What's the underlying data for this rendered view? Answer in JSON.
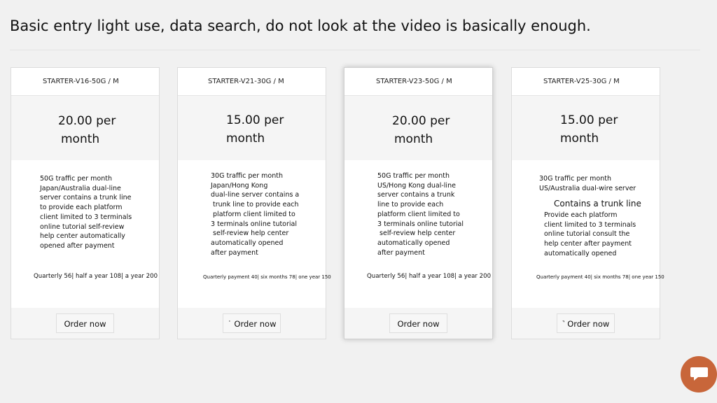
{
  "heading": "Basic entry light use, data search, do not look at the video is basically enough.",
  "cards": [
    {
      "title": "STARTER-V16-50G / M",
      "price_line1": "20.00 per",
      "price_line2": "month",
      "features": "50G traffic per month\nJapan/Australia dual-line\nserver contains a trunk line\nto provide each platform\nclient limited to 3 terminals\nonline tutorial self-review\nhelp center automatically\nopened after payment",
      "pricing": "Quarterly 56| half a year 108| a year 200",
      "order_label": "Order now"
    },
    {
      "title": "STARTER-V21-30G / M",
      "price_line1": "15.00 per",
      "price_line2": "month",
      "features": "30G traffic per month\nJapan/Hong Kong\ndual-line server contains a\n trunk line to provide each\n platform client limited to\n3 terminals online tutorial\n self-review help center\nautomatically opened\nafter payment",
      "pricing": "Quarterly payment 40| six months 78| one year 150",
      "order_label": "˙ Order now"
    },
    {
      "title": "STARTER-V23-50G / M",
      "price_line1": "20.00 per",
      "price_line2": "month",
      "features": "50G traffic per month\nUS/Hong Kong dual-line\nserver contains a trunk\nline to provide each\nplatform client limited to\n3 terminals online tutorial\n self-review help center\nautomatically opened\nafter payment",
      "pricing": "Quarterly 56| half a year 108| a year 200",
      "order_label": "Order now"
    },
    {
      "title": "STARTER-V25-30G / M",
      "price_line1": "15.00 per",
      "price_line2": "month",
      "features_top": "30G traffic per month\nUS/Australia dual-wire server",
      "features_big": "Contains a trunk line",
      "features_bottom": "Provide each platform\nclient limited to 3 terminals\nonline tutorial consult the\nhelp center after payment\nautomatically opened",
      "pricing": "Quarterly payment 40| six months 78| one year 150",
      "order_label": "˺ Order now"
    }
  ],
  "chat": {
    "icon": "chat-bubble-icon",
    "color": "#c8663a"
  }
}
